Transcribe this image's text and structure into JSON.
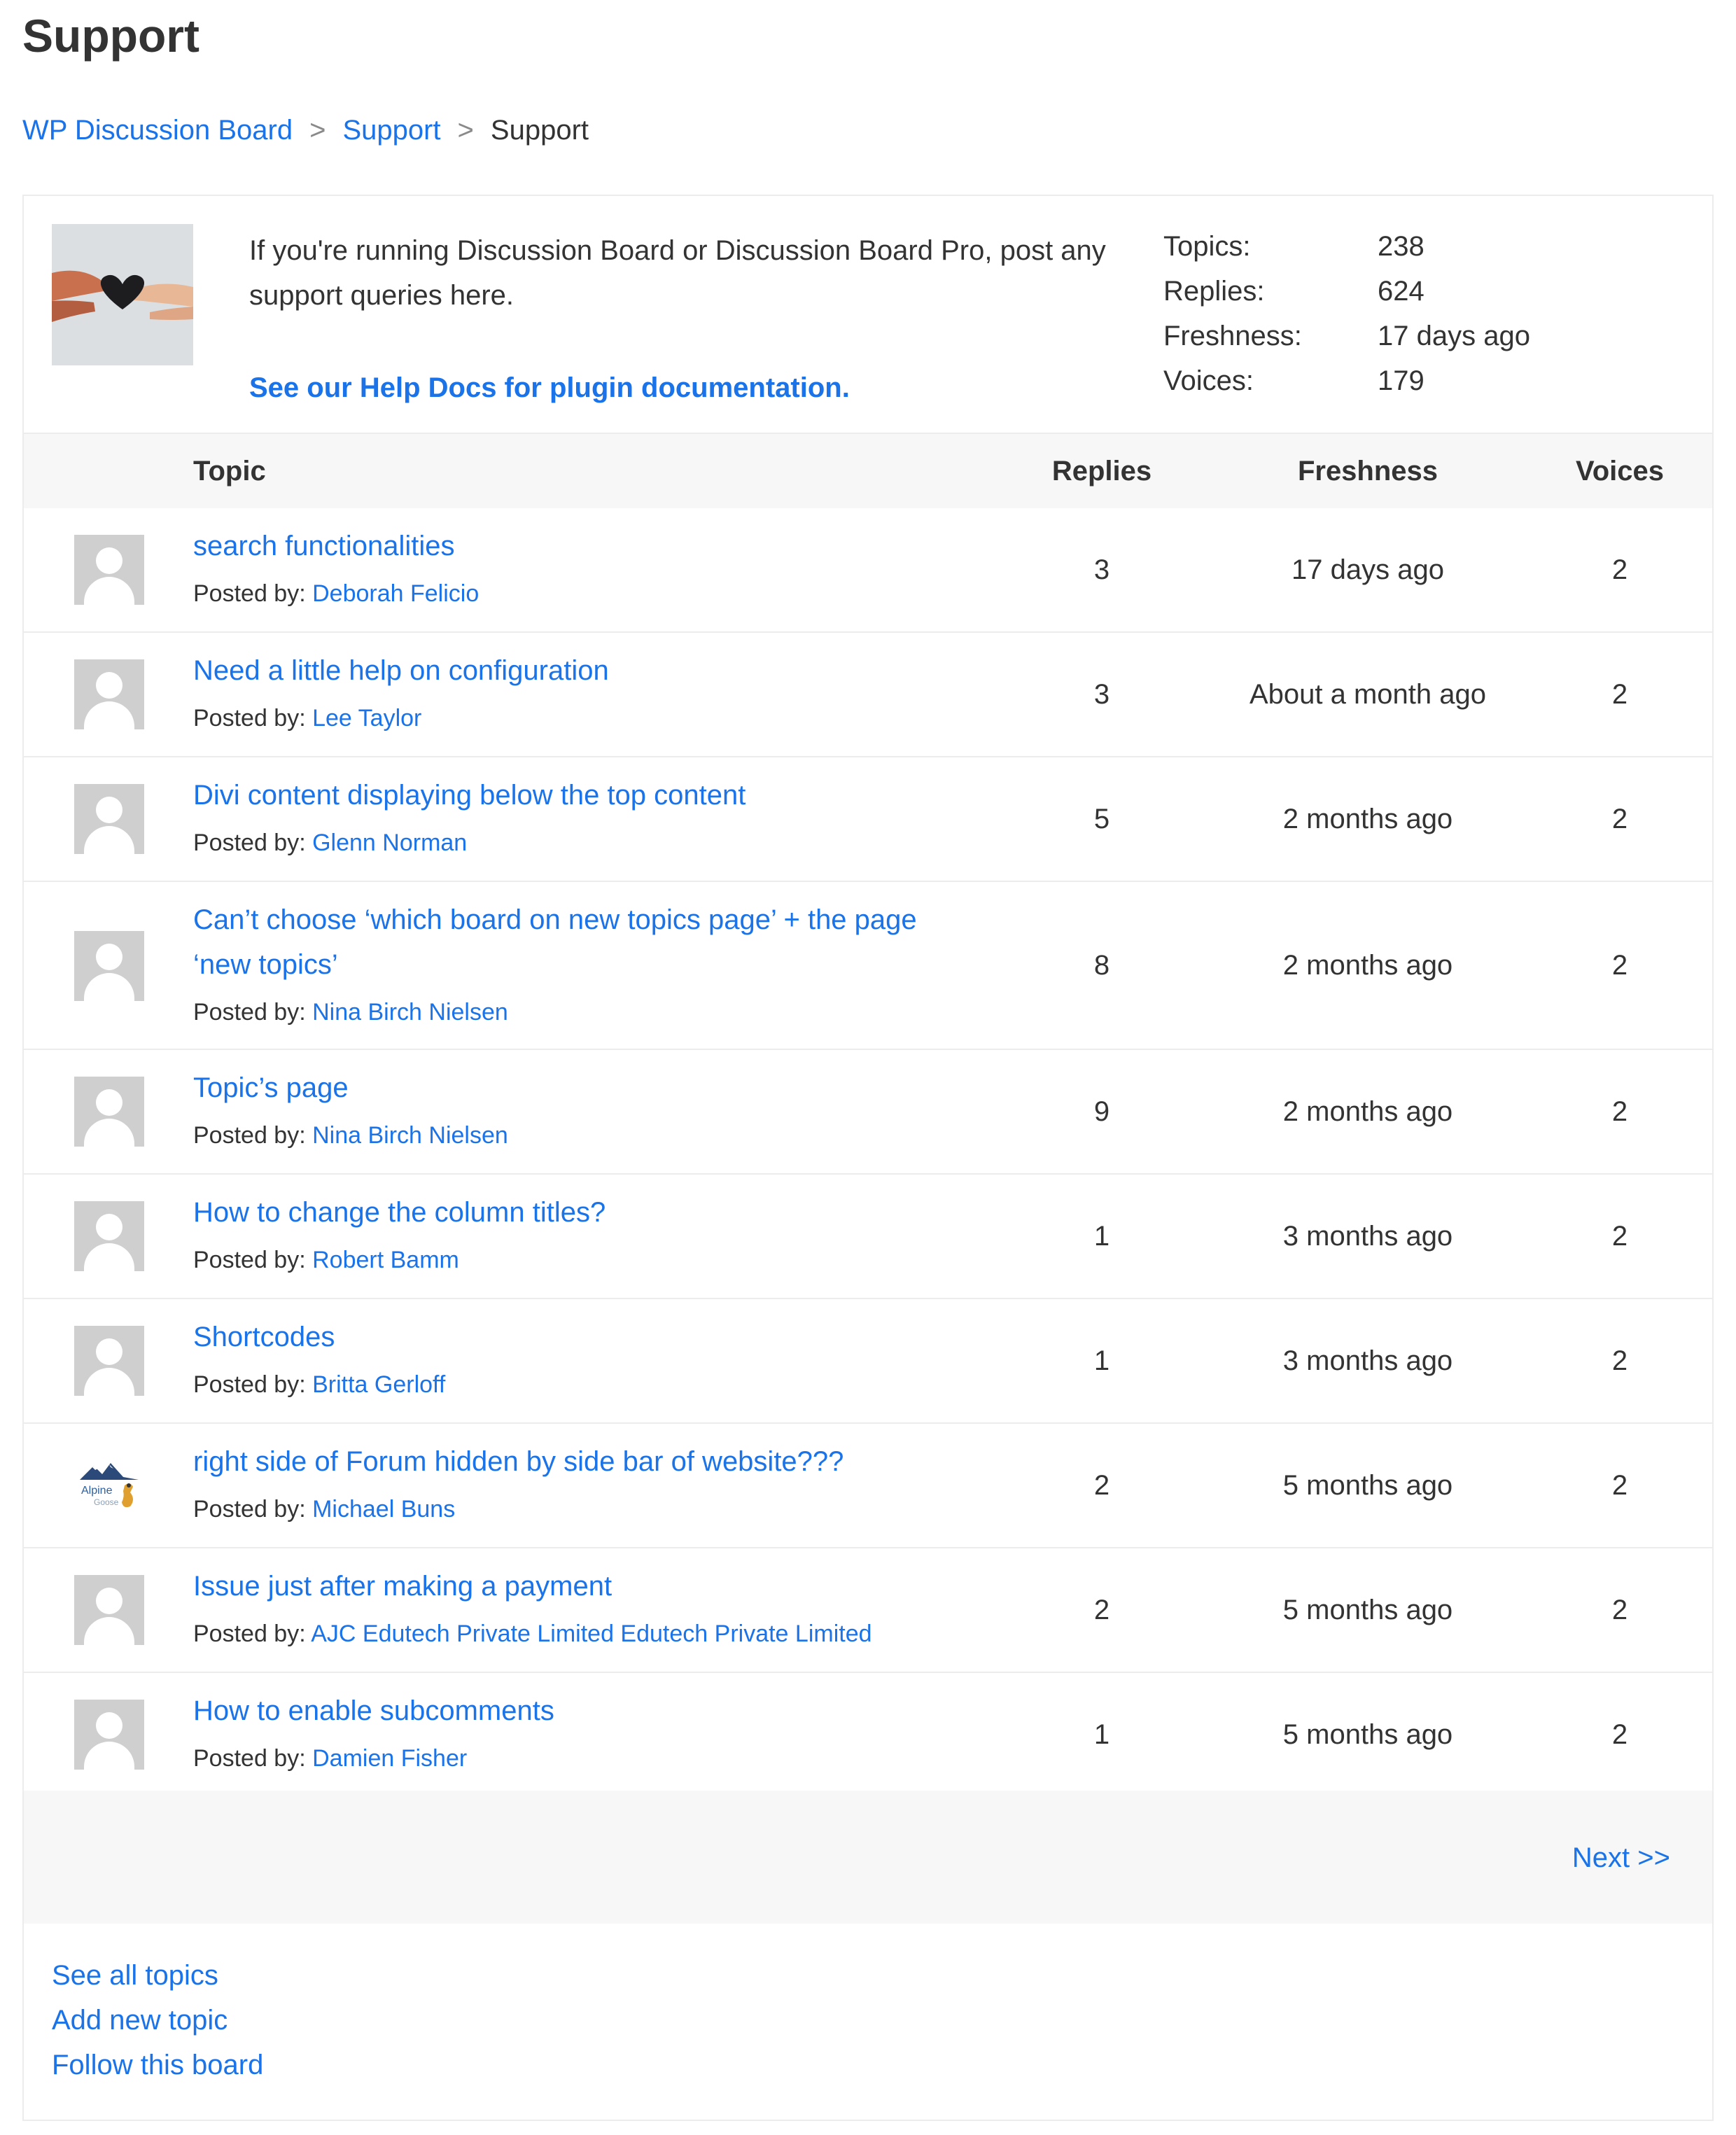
{
  "page": {
    "title": "Support"
  },
  "breadcrumb": {
    "items": [
      "WP Discussion Board",
      "Support"
    ],
    "separator": ">",
    "current": "Support"
  },
  "board": {
    "description": "If you're running Discussion Board or Discussion Board Pro, post any support queries here.",
    "help_link": "See our Help Docs for plugin documentation.",
    "stats": [
      {
        "label": "Topics:",
        "value": "238"
      },
      {
        "label": "Replies:",
        "value": "624"
      },
      {
        "label": "Freshness:",
        "value": "17 days ago"
      },
      {
        "label": "Voices:",
        "value": "179"
      }
    ]
  },
  "table": {
    "headers": {
      "topic": "Topic",
      "replies": "Replies",
      "freshness": "Freshness",
      "voices": "Voices"
    },
    "posted_by_label": "Posted by:",
    "rows": [
      {
        "title": "search functionalities",
        "author": "Deborah Felicio",
        "replies": "3",
        "freshness": "17 days ago",
        "voices": "2"
      },
      {
        "title": "Need a little help on configuration",
        "author": "Lee Taylor",
        "replies": "3",
        "freshness": "About a month ago",
        "voices": "2"
      },
      {
        "title": "Divi content displaying below the top content",
        "author": "Glenn Norman",
        "replies": "5",
        "freshness": "2 months ago",
        "voices": "2"
      },
      {
        "title": "Can’t choose ‘which board on new topics page’ + the page ‘new topics’",
        "author": "Nina Birch Nielsen",
        "replies": "8",
        "freshness": "2 months ago",
        "voices": "2"
      },
      {
        "title": "Topic’s page",
        "author": "Nina Birch Nielsen",
        "replies": "9",
        "freshness": "2 months ago",
        "voices": "2"
      },
      {
        "title": "How to change the column titles?",
        "author": "Robert Bamm",
        "replies": "1",
        "freshness": "3 months ago",
        "voices": "2"
      },
      {
        "title": "Shortcodes",
        "author": "Britta Gerloff",
        "replies": "1",
        "freshness": "3 months ago",
        "voices": "2"
      },
      {
        "title": "right side of Forum hidden by side bar of website???",
        "author": "Michael Buns",
        "replies": "2",
        "freshness": "5 months ago",
        "voices": "2",
        "avatar_text": [
          "Alpine",
          "Goose"
        ]
      },
      {
        "title": "Issue just after making a payment",
        "author": "AJC Edutech Private Limited Edutech Private Limited",
        "replies": "2",
        "freshness": "5 months ago",
        "voices": "2"
      },
      {
        "title": "How to enable subcomments",
        "author": "Damien Fisher",
        "replies": "1",
        "freshness": "5 months ago",
        "voices": "2"
      }
    ]
  },
  "pager": {
    "next": "Next >>"
  },
  "footer_links": [
    "See all topics",
    "Add new topic",
    "Follow this board"
  ]
}
